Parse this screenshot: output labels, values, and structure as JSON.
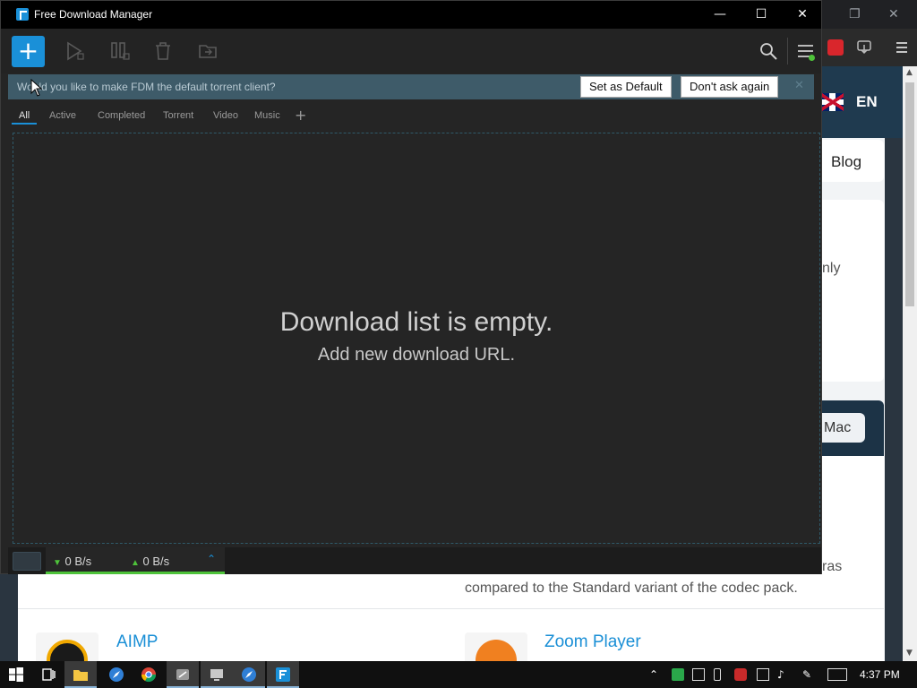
{
  "background_browser": {
    "language_label": "EN",
    "nav_blog": "Blog",
    "card_text_fragment": "nly",
    "mac_button": "Mac",
    "snippet_fragment": "ras",
    "snippet_text": "compared to the Standard variant of the codec pack.",
    "apps": [
      {
        "name": "AIMP",
        "icon_color": "#f0a800"
      },
      {
        "name": "Zoom Player",
        "icon_color": "#f08020"
      }
    ]
  },
  "fdm": {
    "title": "Free Download Manager",
    "accent_color": "#1a90d8",
    "toolbar": {
      "add_label": "+",
      "icons": [
        "resume-icon",
        "pause-icon",
        "delete-icon",
        "move-icon",
        "search-icon",
        "menu-icon"
      ]
    },
    "notification": {
      "message": "Would you like to make FDM the default torrent client?",
      "set_default": "Set as Default",
      "dont_ask": "Don't ask again",
      "close": "✕"
    },
    "tabs": [
      "All",
      "Active",
      "Completed",
      "Torrent",
      "Video",
      "Music"
    ],
    "active_tab": "All",
    "tab_add": "+",
    "empty_state": {
      "title": "Download list is empty.",
      "subtitle": "Add new download URL."
    },
    "status": {
      "down_speed": "0 B/s",
      "up_speed": "0 B/s"
    }
  },
  "taskbar": {
    "clock": "4:37 PM"
  }
}
